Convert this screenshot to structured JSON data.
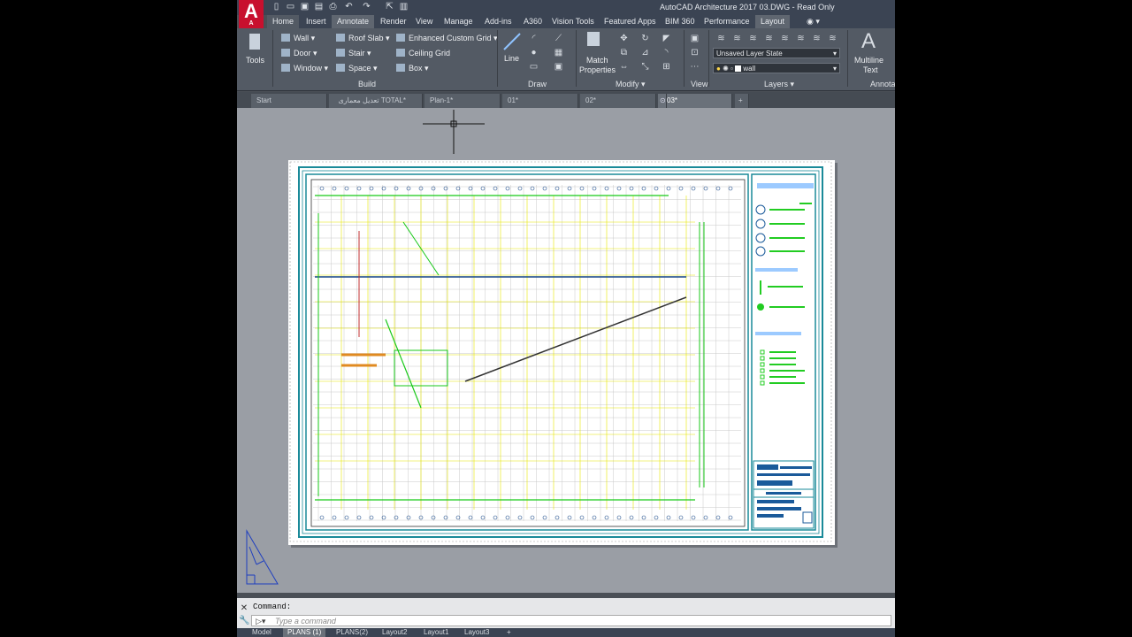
{
  "app": {
    "title": "AutoCAD Architecture 2017    03.DWG - Read Only",
    "logo": "A",
    "logo_sub": "A"
  },
  "ribbon_tabs": [
    "Home",
    "Insert",
    "Annotate",
    "Render",
    "View",
    "Manage",
    "Add-ins",
    "A360",
    "Vision Tools",
    "Featured Apps",
    "BIM 360",
    "Performance",
    "Layout"
  ],
  "ribbon": {
    "tools_label": "Tools",
    "build": {
      "items": [
        "Wall",
        "Door",
        "Window",
        "Roof Slab",
        "Stair",
        "Space",
        "Enhanced Custom Grid",
        "Ceiling Grid",
        "Box"
      ],
      "label": "Build"
    },
    "draw": {
      "line_label": "Line",
      "label": "Draw"
    },
    "modify": {
      "match_label": "Match",
      "properties_label": "Properties",
      "label": "Modify"
    },
    "view": {
      "label": "View"
    },
    "layers": {
      "layer_state": "Unsaved Layer State",
      "current_layer": "wall",
      "label": "Layers"
    },
    "annotation": {
      "multiline_label": "Multiline",
      "text_label": "Text",
      "partial_label": "Annota"
    }
  },
  "doc_tabs": [
    "Start",
    "تعدیل معماری TOTAL*",
    "Plan-1*",
    "01*",
    "02*",
    "03*"
  ],
  "command": {
    "label": "Command:",
    "placeholder": "Type a command"
  },
  "layout_tabs": [
    "Model",
    "PLANS (1)",
    "PLANS(2)",
    "Layout2",
    "Layout1",
    "Layout3"
  ],
  "colors": {
    "ribbon": "#535a64",
    "canvas": "#9a9ea5",
    "cyan_border": "#1a8a99",
    "grid": "#e6e600",
    "drawing": "#18c918"
  }
}
